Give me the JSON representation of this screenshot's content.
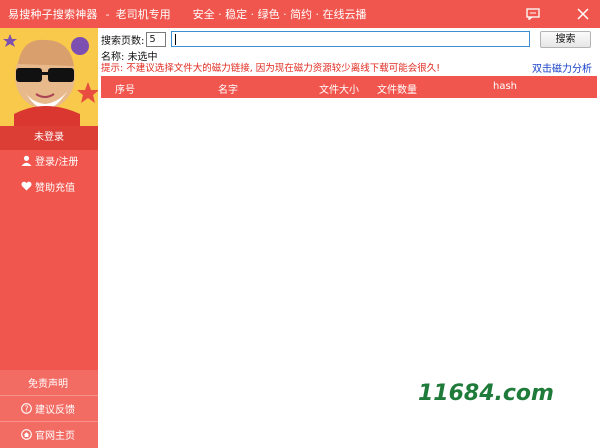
{
  "window": {
    "title": "易搜种子搜索神器",
    "separator": "-",
    "subtitle": "老司机专用",
    "slogan": "安全 · 稳定 · 绿色 · 简约 · 在线云播"
  },
  "sidebar": {
    "login_status": "未登录",
    "items": [
      {
        "label": "登录/注册",
        "icon": "user-icon"
      },
      {
        "label": "赞助充值",
        "icon": "heart-icon"
      }
    ],
    "footer_items": [
      {
        "label": "免责声明"
      },
      {
        "label": "建议反馈",
        "icon": "question-icon"
      },
      {
        "label": "官网主页",
        "icon": "home-icon"
      }
    ]
  },
  "search": {
    "pages_label": "搜索页数:",
    "pages_value": "5",
    "query_value": "",
    "button_label": "搜索"
  },
  "selection": {
    "label": "名称:",
    "value": "未选中"
  },
  "tip": "提示: 不建议选择文件大的磁力链接, 因为现在磁力资源较少离线下载可能会很久!",
  "magnet_analysis_link": "双击磁力分析",
  "table": {
    "columns": [
      "序号",
      "名字",
      "文件大小",
      "文件数量",
      "hash"
    ],
    "rows": []
  },
  "watermark": "11684.com",
  "colors": {
    "accent": "#f1564e",
    "accent_dark": "#dc3e36",
    "link": "#1a43c8",
    "warning": "#e02a20"
  }
}
